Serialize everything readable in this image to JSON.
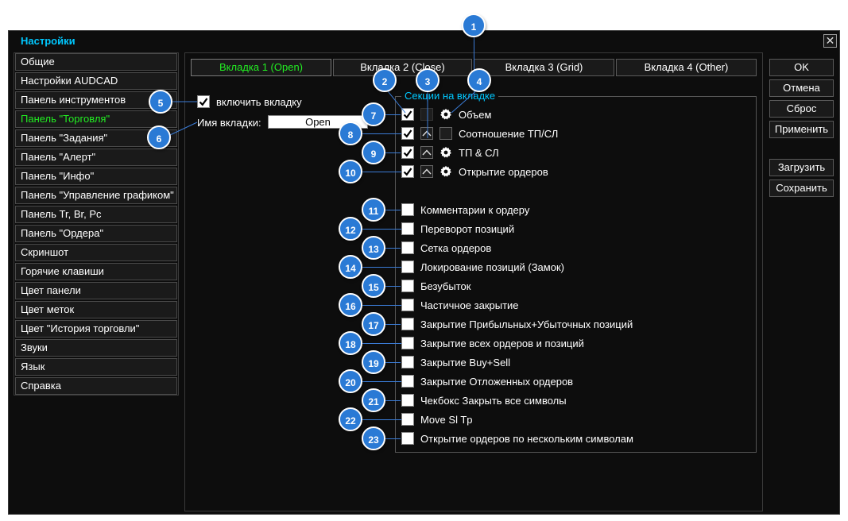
{
  "window": {
    "title": "Настройки",
    "close_glyph": "✕"
  },
  "sidebar": {
    "items": [
      {
        "label": "Общие"
      },
      {
        "label": "Настройки AUDCAD"
      },
      {
        "label": "Панель инструментов"
      },
      {
        "label": "Панель \"Торговля\"",
        "active": true
      },
      {
        "label": "Панель \"Задания\""
      },
      {
        "label": "Панель \"Алерт\""
      },
      {
        "label": "Панель \"Инфо\""
      },
      {
        "label": "Панель \"Управление графиком\""
      },
      {
        "label": "Панель Tr, Br, Pc"
      },
      {
        "label": "Панель \"Ордера\""
      },
      {
        "label": "Скриншот"
      },
      {
        "label": "Горячие клавиши"
      },
      {
        "label": "Цвет панели"
      },
      {
        "label": "Цвет меток"
      },
      {
        "label": "Цвет \"История торговли\""
      },
      {
        "label": "Звуки"
      },
      {
        "label": "Язык"
      },
      {
        "label": "Справка"
      }
    ]
  },
  "tabs": [
    {
      "label": "Вкладка 1 (Open)",
      "active": true
    },
    {
      "label": "Вкладка 2 (Close)"
    },
    {
      "label": "Вкладка 3 (Grid)"
    },
    {
      "label": "Вкладка 4 (Other)"
    }
  ],
  "tab_settings": {
    "enable_label": "включить вкладку",
    "enable_checked": true,
    "name_label": "Имя вкладки:",
    "name_value": "Open"
  },
  "sections": {
    "title": "Секции на вкладке",
    "items": [
      {
        "label": "Объем",
        "checked": true,
        "up_button": false,
        "gear": true
      },
      {
        "label": "Соотношение ТП/СЛ",
        "checked": true,
        "up_button": true,
        "gear": false
      },
      {
        "label": "ТП & СЛ",
        "checked": true,
        "up_button": true,
        "gear": true
      },
      {
        "label": "Открытие ордеров",
        "checked": true,
        "up_button": true,
        "gear": true
      },
      {
        "label": "Комментарии к ордеру",
        "checked": false
      },
      {
        "label": "Переворот позиций",
        "checked": false
      },
      {
        "label": "Сетка ордеров",
        "checked": false
      },
      {
        "label": "Локирование позиций (Замок)",
        "checked": false
      },
      {
        "label": "Безубыток",
        "checked": false
      },
      {
        "label": "Частичное закрытие",
        "checked": false
      },
      {
        "label": "Закрытие Прибыльных+Убыточных позиций",
        "checked": false
      },
      {
        "label": "Закрытие всех ордеров и позиций",
        "checked": false
      },
      {
        "label": "Закрытие Buy+Sell",
        "checked": false
      },
      {
        "label": "Закрытие Отложенных ордеров",
        "checked": false
      },
      {
        "label": "Чекбокс Закрыть все символы",
        "checked": false
      },
      {
        "label": "Move Sl Tp",
        "checked": false
      },
      {
        "label": "Открытие ордеров по нескольким символам",
        "checked": false
      }
    ]
  },
  "buttons": {
    "ok": "OK",
    "cancel": "Отмена",
    "reset": "Сброс",
    "apply": "Применить",
    "load": "Загрузить",
    "save": "Сохранить"
  },
  "callouts": [
    "1",
    "2",
    "3",
    "4",
    "5",
    "6",
    "7",
    "8",
    "9",
    "10",
    "11",
    "12",
    "13",
    "14",
    "15",
    "16",
    "17",
    "18",
    "19",
    "20",
    "21",
    "22",
    "23"
  ],
  "colors": {
    "background": "#0d0d0d",
    "accent_title": "#00c8ff",
    "active_text": "#22ee22",
    "badge": "#2a7ad5"
  }
}
